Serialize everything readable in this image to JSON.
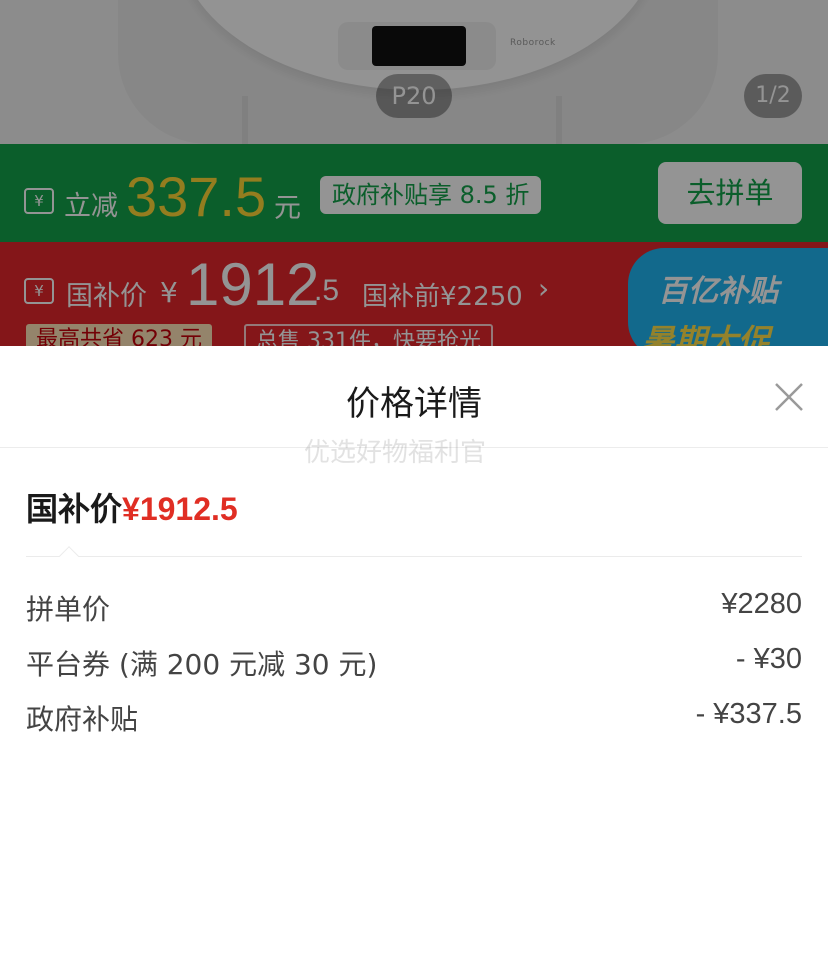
{
  "product_image": {
    "brand_text": "Roborock",
    "model_label": "P20",
    "page_indicator": "1/2"
  },
  "subsidy_banner": {
    "label": "立减",
    "amount": "337.5",
    "unit": "元",
    "discount_text": "政府补贴享 8.5 折",
    "button_label": "去拼单",
    "background_color": "#13a34a",
    "amount_color": "#ffd736"
  },
  "price_banner": {
    "label": "国补价",
    "currency": "¥",
    "price_integer": "1912",
    "price_decimal": ".5",
    "before_label": "国补前¥2250",
    "before_arrow": "›",
    "save_chip": "最高共省 623 元",
    "sold_chip": "总售 331件，快要抢光",
    "promo_line1": "百亿补贴",
    "promo_line2": "暑期大促",
    "background_color": "#e4262c"
  },
  "sheet": {
    "title": "价格详情",
    "close_icon": "close-icon",
    "watermark": "优选好物福利官",
    "gov_price_label": "国补价",
    "gov_price_value": "¥1912.5",
    "accent_color": "#e02e24",
    "rows": [
      {
        "label": "拼单价",
        "value": "¥2280"
      },
      {
        "label": "平台券 (满 200 元减 30 元)",
        "value": "- ¥30"
      },
      {
        "label": "政府补贴",
        "value": "- ¥337.5"
      }
    ]
  }
}
